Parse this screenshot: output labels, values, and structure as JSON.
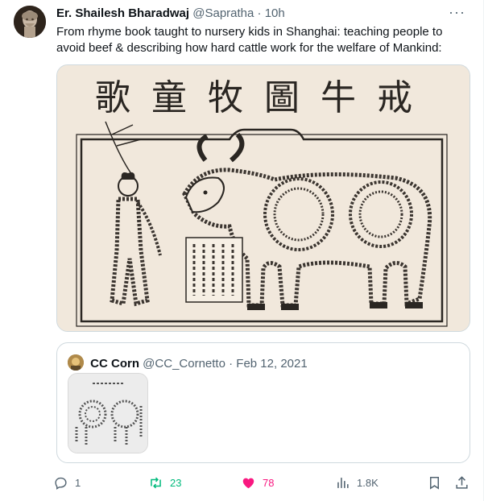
{
  "author": {
    "name": "Er. Shailesh Bharadwaj",
    "handle": "@Sapratha",
    "separator": "·",
    "time": "10h"
  },
  "tweet": {
    "text": "From rhyme book taught to nursery kids in Shanghai: teaching people to avoid beef & describing how hard cattle work for the welfare of Mankind:"
  },
  "media": {
    "title_chars": "歌童牧圖牛戒"
  },
  "quote": {
    "name": "CC Corn",
    "handle": "@CC_Cornetto",
    "separator": "·",
    "date": "Feb 12, 2021"
  },
  "actions": {
    "replies": "1",
    "retweets": "23",
    "likes": "78",
    "views": "1.8K"
  },
  "colors": {
    "retweet": "#00ba7c",
    "like": "#f91880",
    "muted": "#536471",
    "border": "#cfd9de"
  },
  "icons": [
    "more-icon",
    "reply-icon",
    "retweet-icon",
    "like-icon",
    "views-icon",
    "bookmark-icon",
    "share-icon"
  ]
}
